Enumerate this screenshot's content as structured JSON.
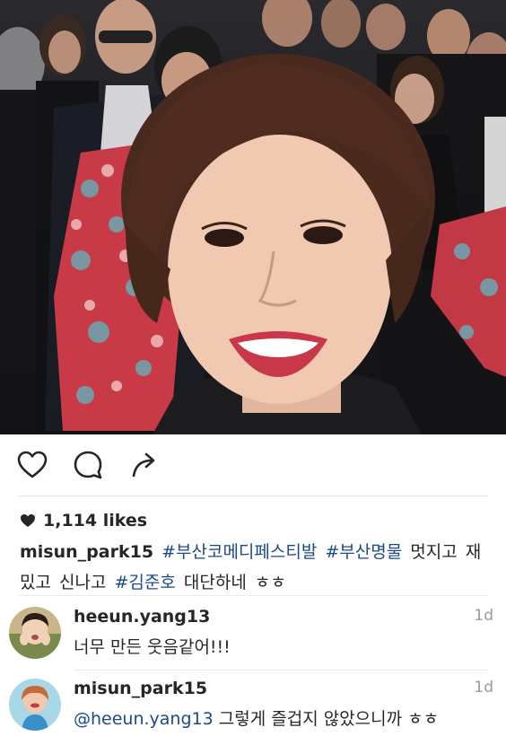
{
  "post": {
    "photo_icon": "selfie-photo",
    "like_icon": "heart-outline-icon",
    "comment_icon": "speech-bubble-icon",
    "share_icon": "share-arrow-icon",
    "likes_count": "1,114 likes"
  },
  "caption": {
    "username": "misun_park15",
    "tag1": "#부산코메디페스티발",
    "tag2": "#부산명물",
    "text1": "멋지고 재",
    "text2": "밌고 신나고",
    "tag3": "#김준호",
    "text3": "대단하네 ㅎㅎ"
  },
  "comments": [
    {
      "username": "heeun.yang13",
      "text": "너무 만든 웃음같어!!!",
      "time": "1d"
    },
    {
      "username": "misun_park15",
      "mention": "@heeun.yang13",
      "text": "그렇게 즐겁지 않았으니까 ㅎㅎ",
      "time": "1d"
    }
  ],
  "colors": {
    "link": "#1a4a8a",
    "text": "#262626",
    "muted": "#999999"
  }
}
